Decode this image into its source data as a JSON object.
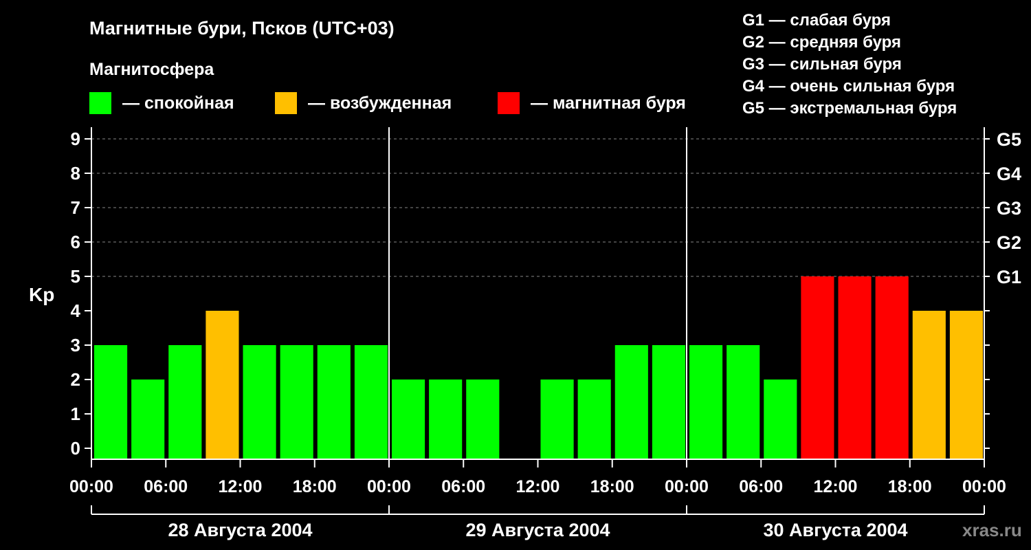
{
  "title": "Магнитные бури, Псков (UTC+03)",
  "legend": {
    "heading": "Магнитосфера",
    "items": [
      {
        "label": "— спокойная",
        "color": "#00ff00"
      },
      {
        "label": "— возбужденная",
        "color": "#ffbf00"
      },
      {
        "label": "— магнитная буря",
        "color": "#ff0000"
      }
    ]
  },
  "g_scale": [
    "G1 — слабая буря",
    "G2 — средняя буря",
    "G3 — сильная буря",
    "G4 — очень сильная буря",
    "G5 — экстремальная буря"
  ],
  "site": "xras.ru",
  "chart_data": {
    "type": "bar",
    "ylabel": "Kp",
    "ylim": [
      0,
      9
    ],
    "grid": "dashed horizontal at Kp 6-9",
    "yticks": [
      "0",
      "1",
      "2",
      "3",
      "4",
      "5",
      "6",
      "7",
      "8",
      "9"
    ],
    "right_ticks": [
      {
        "value": 5,
        "label": "G1"
      },
      {
        "value": 6,
        "label": "G2"
      },
      {
        "value": 7,
        "label": "G3"
      },
      {
        "value": 8,
        "label": "G4"
      },
      {
        "value": 9,
        "label": "G5"
      }
    ],
    "xticks": [
      "00:00",
      "06:00",
      "12:00",
      "18:00",
      "00:00",
      "06:00",
      "12:00",
      "18:00",
      "00:00",
      "06:00",
      "12:00",
      "18:00",
      "00:00"
    ],
    "days": [
      "28 Августа 2004",
      "29 Августа 2004",
      "30 Августа 2004"
    ],
    "interval_hours": 3,
    "values": [
      3,
      2,
      3,
      4,
      3,
      3,
      3,
      3,
      2,
      2,
      2,
      null,
      2,
      2,
      3,
      3,
      3,
      3,
      2,
      5,
      5,
      5,
      4,
      4
    ],
    "colors": [
      "#00ff00",
      "#00ff00",
      "#00ff00",
      "#ffbf00",
      "#00ff00",
      "#00ff00",
      "#00ff00",
      "#00ff00",
      "#00ff00",
      "#00ff00",
      "#00ff00",
      null,
      "#00ff00",
      "#00ff00",
      "#00ff00",
      "#00ff00",
      "#00ff00",
      "#00ff00",
      "#00ff00",
      "#ff0000",
      "#ff0000",
      "#ff0000",
      "#ffbf00",
      "#ffbf00"
    ]
  }
}
